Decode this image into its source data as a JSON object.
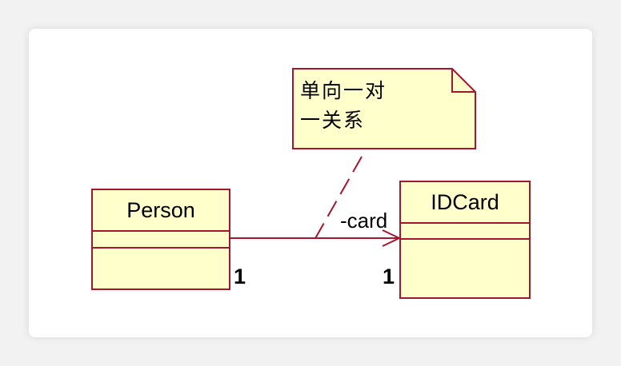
{
  "diagram": {
    "classes": [
      {
        "name": "Person"
      },
      {
        "name": "IDCard"
      }
    ],
    "association": {
      "role": "-card",
      "source_multiplicity": "1",
      "target_multiplicity": "1"
    },
    "note": {
      "lines": [
        "单向一对",
        "一关系"
      ]
    }
  },
  "colors": {
    "class_fill": "#ffffcc",
    "border": "#a3162e",
    "background": "#f2f2f2",
    "card": "#ffffff"
  }
}
